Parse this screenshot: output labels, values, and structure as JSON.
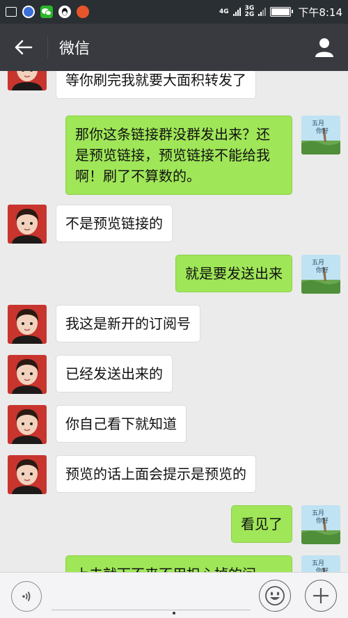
{
  "status_bar": {
    "network_top": "4G",
    "network_3g_top": "3G",
    "network_3g_bottom": "2G",
    "time": "下午8:14",
    "battery_level": 1.0
  },
  "header": {
    "title": "微信"
  },
  "messages": [
    {
      "side": "in",
      "text": "等你刷完我就要大面积转发了"
    },
    {
      "side": "out",
      "text": "那你这条链接群没群发出来？还是预览链接，预览链接不能给我啊！刷了不算数的。"
    },
    {
      "side": "in",
      "text": "不是预览链接的"
    },
    {
      "side": "out",
      "text": "就是要发送出来"
    },
    {
      "side": "in",
      "text": "我这是新开的订阅号"
    },
    {
      "side": "in",
      "text": "已经发送出来的"
    },
    {
      "side": "in",
      "text": "你自己看下就知道"
    },
    {
      "side": "in",
      "text": "预览的话上面会提示是预览的"
    },
    {
      "side": "out",
      "text": "看见了"
    },
    {
      "side": "out",
      "text": "上去就下不来不用担心掉的问"
    }
  ],
  "outgoing_avatar_text": "五月你好",
  "input_bar": {
    "placeholder": ""
  }
}
